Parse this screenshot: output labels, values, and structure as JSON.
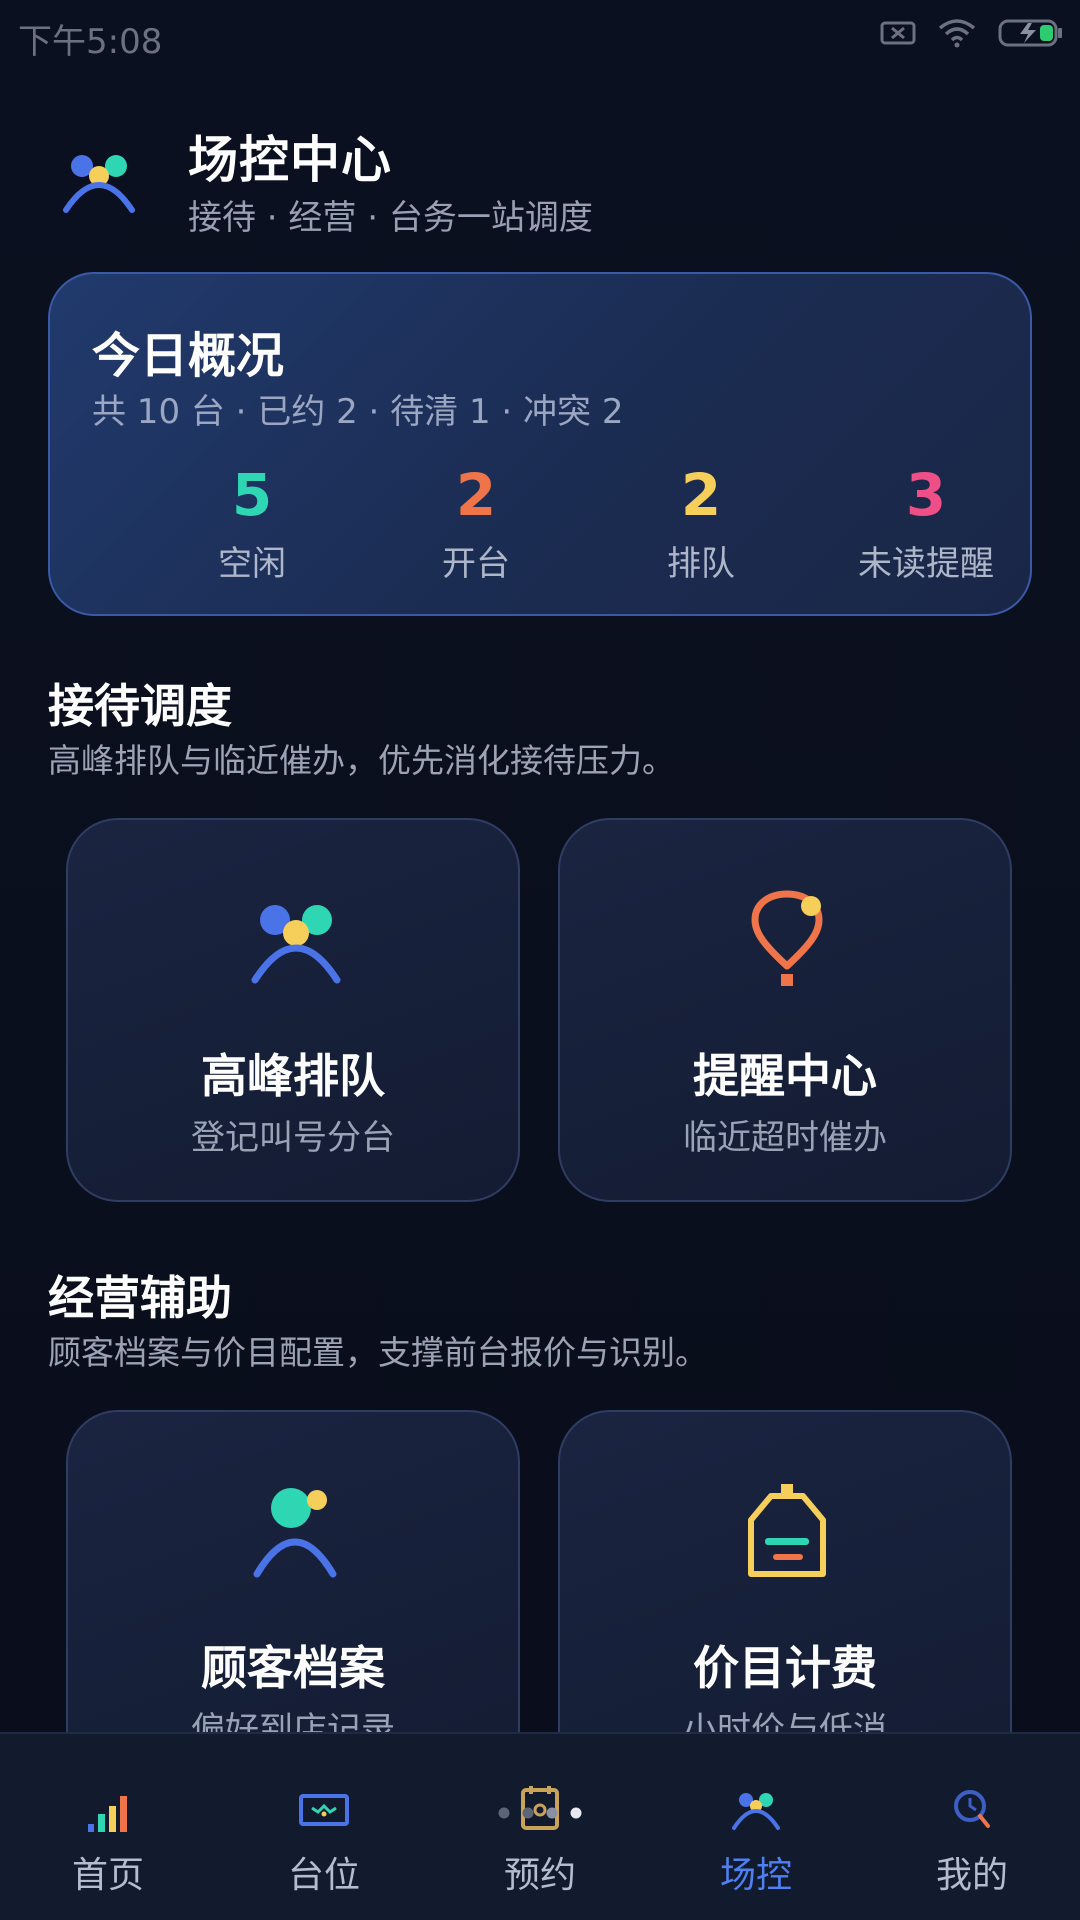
{
  "status_bar": {
    "time": "下午5:08",
    "icons": [
      "sim-x-icon",
      "wifi-icon",
      "battery-charging-icon"
    ]
  },
  "header": {
    "title": "场控中心",
    "subtitle": "接待 · 经营 · 台务一站调度",
    "logo_icon": "people-icon"
  },
  "summary": {
    "title": "今日概况",
    "description": "共 10 台 · 已约 2 · 待清 1 · 冲突 2",
    "stats": [
      {
        "value": "5",
        "label": "空闲",
        "color": "#2fd6b4"
      },
      {
        "value": "2",
        "label": "开台",
        "color": "#f0744a"
      },
      {
        "value": "2",
        "label": "排队",
        "color": "#f6cf5b"
      },
      {
        "value": "3",
        "label": "未读提醒",
        "color": "#ee4f86"
      }
    ]
  },
  "sections": [
    {
      "title": "接待调度",
      "description": "高峰排队与临近催办，优先消化接待压力。",
      "tiles": [
        {
          "title": "高峰排队",
          "subtitle": "登记叫号分台",
          "icon": "queue-people-icon"
        },
        {
          "title": "提醒中心",
          "subtitle": "临近超时催办",
          "icon": "alert-pin-icon"
        }
      ]
    },
    {
      "title": "经营辅助",
      "description": "顾客档案与价目配置，支撑前台报价与识别。",
      "tiles": [
        {
          "title": "顾客档案",
          "subtitle": "偏好到店记录",
          "icon": "customer-profile-icon"
        },
        {
          "title": "价目计费",
          "subtitle": "小时价与低消",
          "icon": "price-tag-icon"
        }
      ]
    }
  ],
  "bottom_nav": {
    "items": [
      {
        "label": "首页",
        "icon": "bar-chart-icon",
        "active": false
      },
      {
        "label": "台位",
        "icon": "table-icon",
        "active": false
      },
      {
        "label": "预约",
        "icon": "calendar-icon",
        "active": false
      },
      {
        "label": "场控",
        "icon": "people-icon",
        "active": true
      },
      {
        "label": "我的",
        "icon": "clock-search-icon",
        "active": false
      }
    ]
  },
  "colors": {
    "background": "#0a0f1c",
    "accent": "#4f7ff0",
    "teal": "#2fd6b4",
    "orange": "#f0744a",
    "yellow": "#f6cf5b",
    "pink": "#ee4f86"
  }
}
